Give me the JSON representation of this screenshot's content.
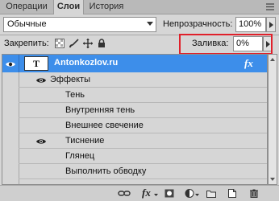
{
  "tabs": [
    {
      "label": "Операции"
    },
    {
      "label": "Слои"
    },
    {
      "label": "История"
    }
  ],
  "blend_mode": {
    "value": "Обычные"
  },
  "opacity": {
    "label": "Непрозрачность:",
    "value": "100%"
  },
  "lock": {
    "label": "Закрепить:"
  },
  "fill": {
    "label": "Заливка:",
    "value": "0%"
  },
  "layer": {
    "thumb": "T",
    "name": "Antonkozlov.ru",
    "fx": "fx"
  },
  "effects": {
    "header": "Эффекты",
    "items": [
      {
        "label": "Тень",
        "visible": false
      },
      {
        "label": "Внутренняя тень",
        "visible": false
      },
      {
        "label": "Внешнее свечение",
        "visible": false
      },
      {
        "label": "Тиснение",
        "visible": true
      },
      {
        "label": "Глянец",
        "visible": false
      },
      {
        "label": "Выполнить обводку",
        "visible": false
      }
    ]
  },
  "bottom": {
    "fx": "fx"
  },
  "colors": {
    "selection": "#3d8eea",
    "highlight": "#e0202a",
    "panel": "#d6d6d6"
  }
}
